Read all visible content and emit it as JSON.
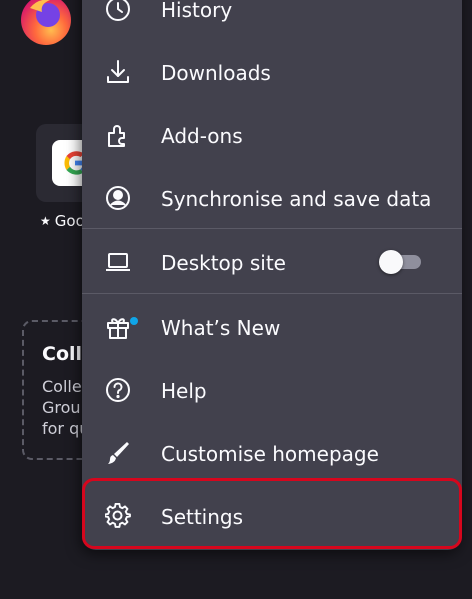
{
  "background": {
    "shortcut_label": "Goo",
    "collections_title": "Colle",
    "collections_desc_lines": [
      "Colle",
      "Grou",
      "for qu"
    ]
  },
  "menu": {
    "items": [
      {
        "label": "History",
        "icon": "clock-icon"
      },
      {
        "label": "Downloads",
        "icon": "download-icon"
      },
      {
        "label": "Add-ons",
        "icon": "puzzle-icon"
      },
      {
        "label": "Synchronise and save data",
        "icon": "account-icon"
      },
      {
        "label": "Desktop site",
        "icon": "laptop-icon",
        "toggle_on": false
      },
      {
        "label": "What’s New",
        "icon": "gift-icon",
        "badge": true
      },
      {
        "label": "Help",
        "icon": "help-icon"
      },
      {
        "label": "Customise homepage",
        "icon": "paintbrush-icon"
      },
      {
        "label": "Settings",
        "icon": "gear-icon",
        "highlighted": true
      }
    ]
  },
  "colors": {
    "menu_background": "#42414d",
    "page_background": "#1c1b22",
    "text": "#fbfbfe",
    "highlight_border": "#d6061d",
    "badge": "#0fa5e8"
  }
}
